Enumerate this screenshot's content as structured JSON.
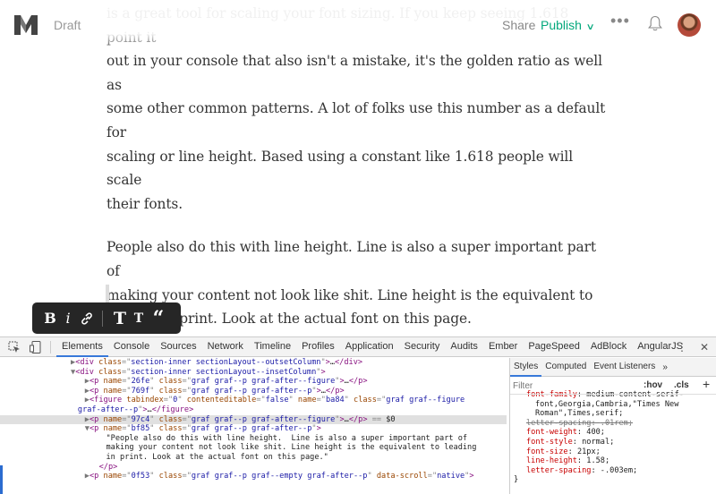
{
  "header": {
    "draft_label": "Draft",
    "share_label": "Share",
    "publish_label": "Publish",
    "more_label": "•••",
    "accent_color": "#03a87c"
  },
  "article": {
    "paragraph1_lines": [
      "is a great tool for scaling your font sizing. If you keep seeing 1.618 point it",
      "out in your console that also isn't a mistake, it's the golden ratio as well as",
      "some other common patterns. A lot of folks use this number as a default for",
      "scaling or line height. Based using a constant like 1.618 people will scale",
      "their fonts."
    ],
    "paragraph2_lines": [
      "People also do this with line height. Line is also a super important part of",
      "making your content not look like shit. Line height is the equivalent to",
      "leading in print. Look at the actual font on this page."
    ]
  },
  "format_toolbar": {
    "bold": "B",
    "italic": "i",
    "heading_large": "T",
    "heading_small": "T",
    "quote": "“"
  },
  "devtools": {
    "tabs": [
      "Elements",
      "Console",
      "Sources",
      "Network",
      "Timeline",
      "Profiles",
      "Application",
      "Security",
      "Audits",
      "Ember",
      "PageSpeed",
      "AdBlock",
      "AngularJS"
    ],
    "active_tab": "Elements",
    "menu_label": "⋮",
    "close_label": "✕",
    "dom_lines": [
      {
        "indent": 10,
        "tri": "▶",
        "parts": [
          [
            "tag",
            "<div "
          ],
          [
            "attr",
            "class"
          ],
          [
            "eq",
            "=\""
          ],
          [
            "val",
            "section-inner sectionLayout--outsetColumn"
          ],
          [
            "eq",
            "\""
          ],
          [
            "tag",
            ">"
          ],
          [
            "txt",
            "…"
          ],
          [
            "tag",
            "</div>"
          ]
        ]
      },
      {
        "indent": 10,
        "tri": "▼",
        "parts": [
          [
            "tag",
            "<div "
          ],
          [
            "attr",
            "class"
          ],
          [
            "eq",
            "=\""
          ],
          [
            "val",
            "section-inner sectionLayout--insetColumn"
          ],
          [
            "eq",
            "\""
          ],
          [
            "tag",
            ">"
          ]
        ]
      },
      {
        "indent": 12,
        "tri": "▶",
        "parts": [
          [
            "tag",
            "<p "
          ],
          [
            "attr",
            "name"
          ],
          [
            "eq",
            "=\""
          ],
          [
            "val",
            "26fe"
          ],
          [
            "eq",
            "\" "
          ],
          [
            "attr",
            "class"
          ],
          [
            "eq",
            "=\""
          ],
          [
            "val",
            "graf graf--p graf-after--figure"
          ],
          [
            "eq",
            "\""
          ],
          [
            "tag",
            ">"
          ],
          [
            "txt",
            "…"
          ],
          [
            "tag",
            "</p>"
          ]
        ]
      },
      {
        "indent": 12,
        "tri": "▶",
        "parts": [
          [
            "tag",
            "<p "
          ],
          [
            "attr",
            "name"
          ],
          [
            "eq",
            "=\""
          ],
          [
            "val",
            "769f"
          ],
          [
            "eq",
            "\" "
          ],
          [
            "attr",
            "class"
          ],
          [
            "eq",
            "=\""
          ],
          [
            "val",
            "graf graf--p graf-after--p"
          ],
          [
            "eq",
            "\""
          ],
          [
            "tag",
            ">"
          ],
          [
            "txt",
            "…"
          ],
          [
            "tag",
            "</p>"
          ]
        ]
      },
      {
        "indent": 12,
        "tri": "▶",
        "parts": [
          [
            "tag",
            "<figure "
          ],
          [
            "attr",
            "tabindex"
          ],
          [
            "eq",
            "=\""
          ],
          [
            "val",
            "0"
          ],
          [
            "eq",
            "\" "
          ],
          [
            "attr",
            "contenteditable"
          ],
          [
            "eq",
            "=\""
          ],
          [
            "val",
            "false"
          ],
          [
            "eq",
            "\" "
          ],
          [
            "attr",
            "name"
          ],
          [
            "eq",
            "=\""
          ],
          [
            "val",
            "ba84"
          ],
          [
            "eq",
            "\" "
          ],
          [
            "attr",
            "class"
          ],
          [
            "eq",
            "=\""
          ],
          [
            "val",
            "graf graf--figure"
          ]
        ]
      },
      {
        "indent": 11,
        "tri": "",
        "parts": [
          [
            "val",
            "graf-after--p"
          ],
          [
            "eq",
            "\""
          ],
          [
            "tag",
            ">"
          ],
          [
            "txt",
            "…"
          ],
          [
            "tag",
            "</figure>"
          ]
        ]
      },
      {
        "indent": 12,
        "tri": "▶",
        "selected": true,
        "parts": [
          [
            "tag",
            "<p "
          ],
          [
            "attr",
            "name"
          ],
          [
            "eq",
            "=\""
          ],
          [
            "val",
            "97c4"
          ],
          [
            "eq",
            "\" "
          ],
          [
            "attr",
            "class"
          ],
          [
            "eq",
            "=\""
          ],
          [
            "val",
            "graf graf--p graf-after--figure"
          ],
          [
            "eq",
            "\""
          ],
          [
            "tag",
            ">"
          ],
          [
            "txt",
            "…"
          ],
          [
            "tag",
            "</p>"
          ],
          [
            "eq",
            " == "
          ],
          [
            "txt",
            "$0"
          ]
        ]
      },
      {
        "indent": 12,
        "tri": "▼",
        "parts": [
          [
            "tag",
            "<p "
          ],
          [
            "attr",
            "name"
          ],
          [
            "eq",
            "=\""
          ],
          [
            "val",
            "bf85"
          ],
          [
            "eq",
            "\" "
          ],
          [
            "attr",
            "class"
          ],
          [
            "eq",
            "=\""
          ],
          [
            "val",
            "graf graf--p graf-after--p"
          ],
          [
            "eq",
            "\""
          ],
          [
            "tag",
            ">"
          ]
        ]
      },
      {
        "indent": 15,
        "tri": "",
        "parts": [
          [
            "txt",
            "\"People also do this with line height.  Line is also a super important part of"
          ]
        ]
      },
      {
        "indent": 15,
        "tri": "",
        "parts": [
          [
            "txt",
            "making your content not look like shit. Line height is the equivalent to leading"
          ]
        ]
      },
      {
        "indent": 15,
        "tri": "",
        "parts": [
          [
            "txt",
            "in print. Look at the actual font on this page.\""
          ]
        ]
      },
      {
        "indent": 14,
        "tri": "",
        "parts": [
          [
            "tag",
            "</p>"
          ]
        ]
      },
      {
        "indent": 12,
        "tri": "▶",
        "parts": [
          [
            "tag",
            "<p "
          ],
          [
            "attr",
            "name"
          ],
          [
            "eq",
            "=\""
          ],
          [
            "val",
            "0f53"
          ],
          [
            "eq",
            "\" "
          ],
          [
            "attr",
            "class"
          ],
          [
            "eq",
            "=\""
          ],
          [
            "val",
            "graf graf--p graf--empty graf-after--p"
          ],
          [
            "eq",
            "\" "
          ],
          [
            "attr",
            "data-scroll"
          ],
          [
            "eq",
            "=\""
          ],
          [
            "val",
            "native"
          ],
          [
            "eq",
            "\""
          ],
          [
            "tag",
            ">"
          ]
        ]
      }
    ],
    "styles": {
      "tabs": [
        "Styles",
        "Computed",
        "Event Listeners"
      ],
      "active_tab": "Styles",
      "more_label": "»",
      "filter_placeholder": "Filter",
      "hov_label": ":hov",
      "cls_label": ".cls",
      "plus_label": "+",
      "rules": [
        {
          "prop": "font-family",
          "value": "medium-content-serif-",
          "strike": false,
          "partial": true
        },
        {
          "prop": "",
          "value": "font,Georgia,Cambria,\"Times New",
          "strike": false
        },
        {
          "prop": "",
          "value": "Roman\",Times,serif;",
          "strike": false
        },
        {
          "prop": "letter-spacing",
          "value": ".01rem;",
          "strike": true
        },
        {
          "prop": "font-weight",
          "value": "400;",
          "strike": false
        },
        {
          "prop": "font-style",
          "value": "normal;",
          "strike": false
        },
        {
          "prop": "font-size",
          "value": "21px;",
          "strike": false
        },
        {
          "prop": "line-height",
          "value": "1.58;",
          "strike": false
        },
        {
          "prop": "letter-spacing",
          "value": "-.003em;",
          "strike": false
        }
      ],
      "closing_brace": "}"
    }
  }
}
